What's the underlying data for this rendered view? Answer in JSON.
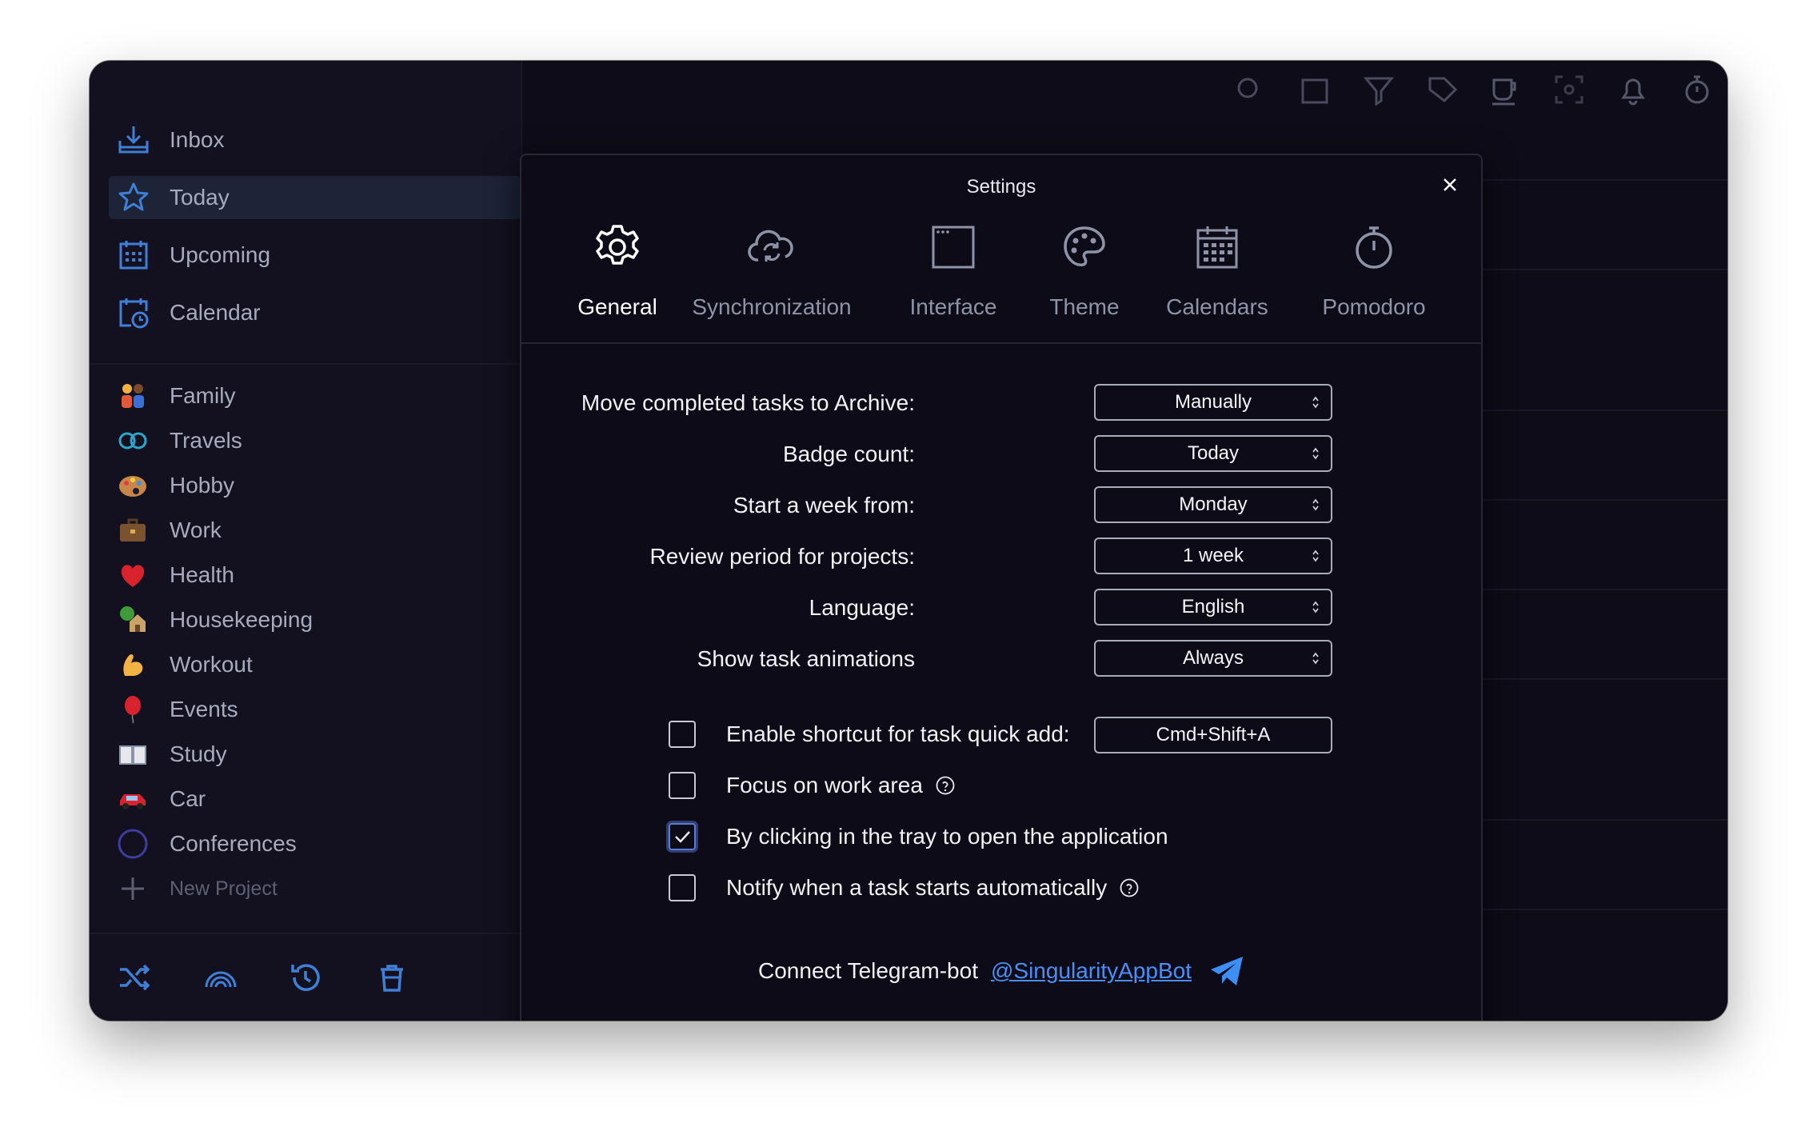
{
  "sidebar": {
    "nav": [
      {
        "label": "Inbox",
        "icon": "inbox-icon"
      },
      {
        "label": "Today",
        "icon": "star-icon",
        "active": true
      },
      {
        "label": "Upcoming",
        "icon": "calendar-grid-icon"
      },
      {
        "label": "Calendar",
        "icon": "calendar-clock-icon"
      }
    ],
    "projects": [
      {
        "label": "Family",
        "icon": "family-emoji-icon"
      },
      {
        "label": "Travels",
        "icon": "infinity-icon"
      },
      {
        "label": "Hobby",
        "icon": "palette-emoji-icon"
      },
      {
        "label": "Work",
        "icon": "briefcase-emoji-icon"
      },
      {
        "label": "Health",
        "icon": "heart-emoji-icon"
      },
      {
        "label": "Housekeeping",
        "icon": "house-emoji-icon"
      },
      {
        "label": "Workout",
        "icon": "muscle-emoji-icon"
      },
      {
        "label": "Events",
        "icon": "balloon-emoji-icon"
      },
      {
        "label": "Study",
        "icon": "book-emoji-icon"
      },
      {
        "label": "Car",
        "icon": "car-emoji-icon"
      },
      {
        "label": "Conferences",
        "icon": "circle-icon"
      }
    ],
    "new_project": "New Project"
  },
  "settings": {
    "title": "Settings",
    "tabs": [
      {
        "label": "General",
        "icon": "gear-icon",
        "active": true
      },
      {
        "label": "Synchronization",
        "icon": "cloud-sync-icon"
      },
      {
        "label": "Interface",
        "icon": "window-icon"
      },
      {
        "label": "Theme",
        "icon": "palette-icon"
      },
      {
        "label": "Calendars",
        "icon": "calendar-icon"
      },
      {
        "label": "Pomodoro",
        "icon": "stopwatch-icon"
      }
    ],
    "fields": [
      {
        "label": "Move completed tasks to Archive:",
        "value": "Manually"
      },
      {
        "label": "Badge count:",
        "value": "Today"
      },
      {
        "label": "Start a week from:",
        "value": "Monday"
      },
      {
        "label": "Review period for projects:",
        "value": "1 week"
      },
      {
        "label": "Language:",
        "value": "English"
      },
      {
        "label": "Show task animations",
        "value": "Always"
      }
    ],
    "checkboxes": [
      {
        "label": "Enable shortcut for task quick add:",
        "checked": false,
        "shortcut": "Cmd+Shift+A"
      },
      {
        "label": "Focus on work area",
        "checked": false,
        "help": true
      },
      {
        "label": "By clicking in the tray to open the application",
        "checked": true
      },
      {
        "label": "Notify when a task starts automatically",
        "checked": false,
        "help": true
      }
    ],
    "telegram": {
      "text": "Connect Telegram-bot",
      "link": "@SingularityAppBot"
    }
  },
  "colors": {
    "accent": "#4a8ff7",
    "sidebar_icon": "#3f7fd6",
    "window_bg": "#0f0d1a"
  }
}
